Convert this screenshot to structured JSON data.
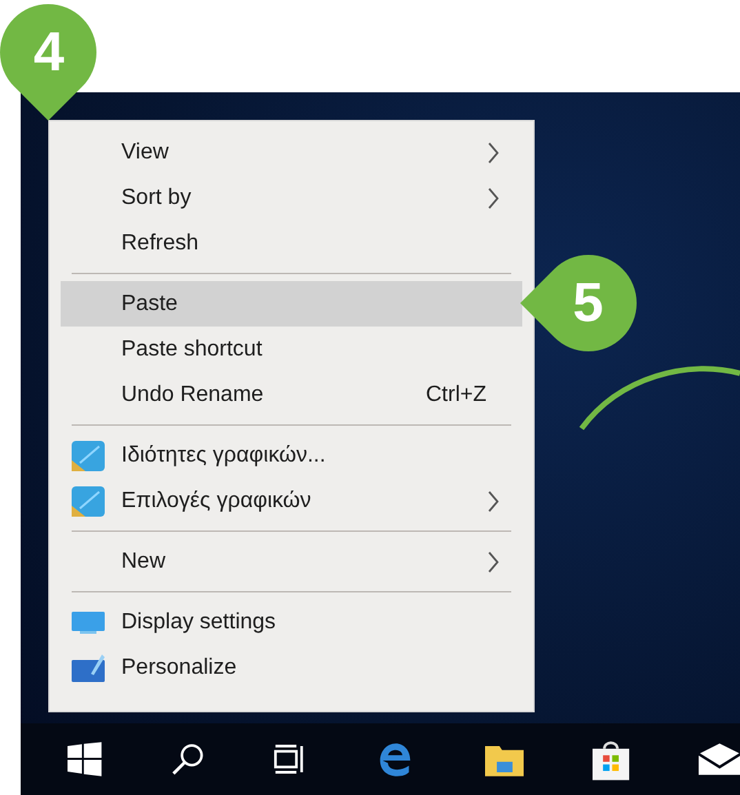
{
  "badges": [
    {
      "label": "4"
    },
    {
      "label": "5"
    }
  ],
  "context_menu": {
    "items": [
      {
        "kind": "plain",
        "label": "View",
        "submenu": true,
        "selected": false
      },
      {
        "kind": "plain",
        "label": "Sort by",
        "submenu": true,
        "selected": false
      },
      {
        "kind": "plain",
        "label": "Refresh",
        "submenu": false,
        "selected": false
      },
      {
        "kind": "separator"
      },
      {
        "kind": "plain",
        "label": "Paste",
        "submenu": false,
        "selected": true
      },
      {
        "kind": "plain",
        "label": "Paste shortcut",
        "submenu": false,
        "selected": false
      },
      {
        "kind": "plain",
        "label": "Undo Rename",
        "shortcut": "Ctrl+Z",
        "submenu": false,
        "selected": false
      },
      {
        "kind": "separator"
      },
      {
        "kind": "graphics",
        "label": "Ιδιότητες γραφικών...",
        "submenu": false,
        "selected": false
      },
      {
        "kind": "graphics",
        "label": "Επιλογές γραφικών",
        "submenu": true,
        "selected": false
      },
      {
        "kind": "separator"
      },
      {
        "kind": "plain",
        "label": "New",
        "submenu": true,
        "selected": false
      },
      {
        "kind": "separator"
      },
      {
        "kind": "display",
        "label": "Display settings",
        "submenu": false,
        "selected": false
      },
      {
        "kind": "personalize",
        "label": "Personalize",
        "submenu": false,
        "selected": false
      }
    ]
  }
}
